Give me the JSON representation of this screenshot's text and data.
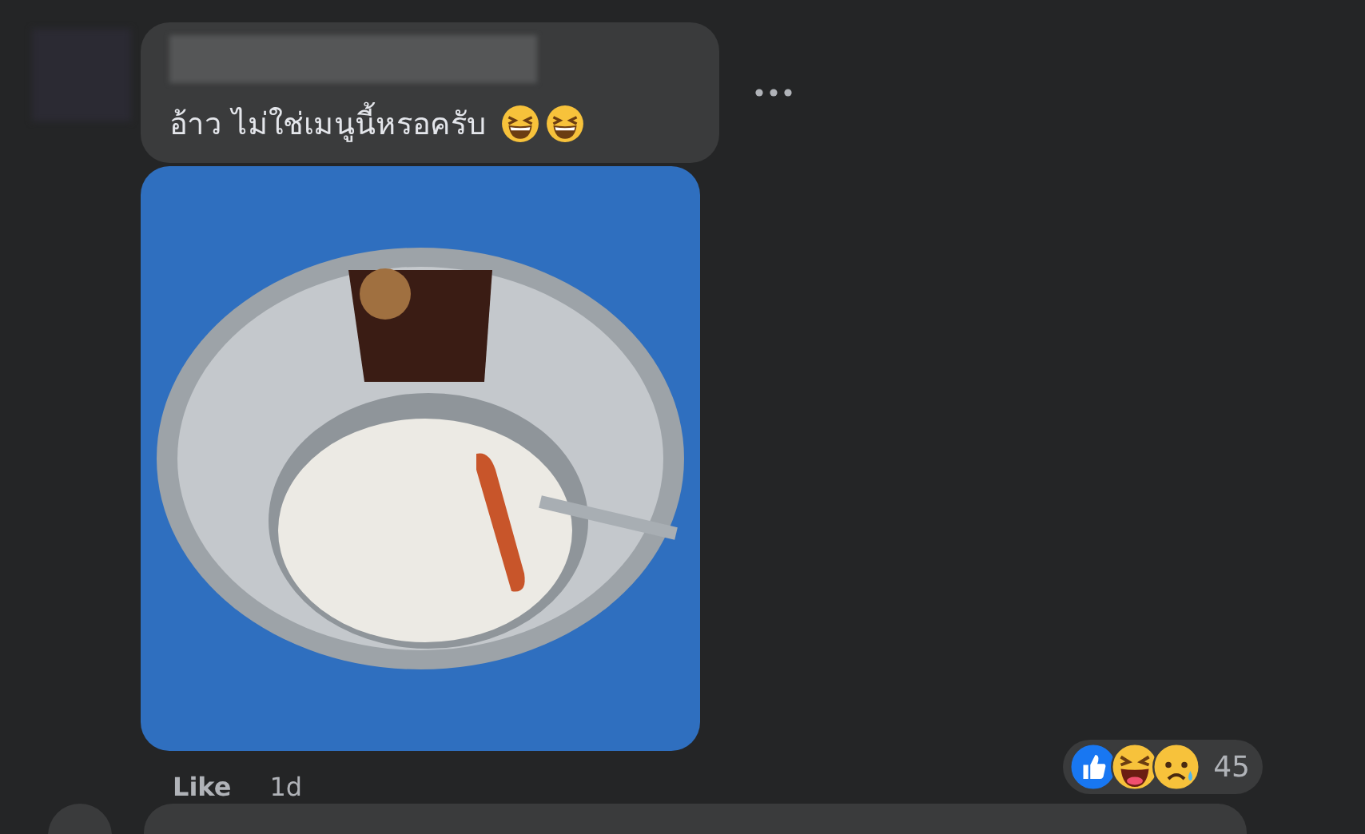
{
  "comment": {
    "text": "อ้าว ไม่ใช่เมนูนี้หรอครับ",
    "reaction_count": "45",
    "like_action": "Like",
    "time": "1d"
  }
}
